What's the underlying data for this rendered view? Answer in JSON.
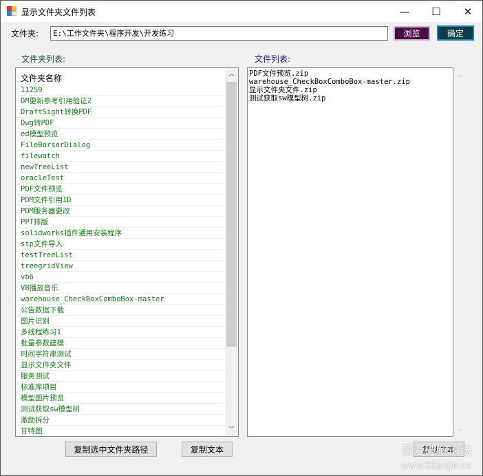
{
  "window": {
    "title": "显示文件夹文件列表",
    "minimize": "—",
    "maximize": "☐",
    "close": "✕"
  },
  "top": {
    "label": "文件夹:",
    "path": "E:\\工作文件夹\\程序开发\\开发练习",
    "browse": "浏览",
    "ok": "确定"
  },
  "folders": {
    "label": "文件夹列表:",
    "header": "文件夹名称",
    "items": [
      "11259",
      "DM更新参考引用验证2",
      "DraftSight转换PDF",
      "Dwg转PDF",
      "ed模型预览",
      "FileBorserDialog",
      "filewatch",
      "newTreeList",
      "oracleTest",
      "PDF文件预览",
      "PDM文件引用ID",
      "PDM服务器更改",
      "PPT排版",
      "solidworks插件通用安装程序",
      "stp文件导入",
      "testTreeList",
      "treegridView",
      "vb6",
      "VB播放音乐",
      "warehouse_CheckBoxComboBox-master",
      "公告数据下载",
      "图片识别",
      "多线程练习1",
      "批量参数建模",
      "时间字符串测试",
      "显示文件夹文件",
      "服务测试",
      "标准库项目",
      "模型图片预览",
      "测试获取sw模型树",
      "激励拆分",
      "甘特图"
    ]
  },
  "files": {
    "label": "文件列表:",
    "items": [
      "PDF文件预览.zip",
      "warehouse_CheckBoxComboBox-master.zip",
      "显示文件夹文件.zip",
      "测试获取sw模型树.zip"
    ]
  },
  "buttons": {
    "copy_path": "复制选中文件夹路径",
    "copy_text": "复制文本",
    "copy_text2": "复制文本"
  },
  "watermark": {
    "line1": "吾爱破解论坛",
    "line2": "www.52pojie.cn"
  }
}
